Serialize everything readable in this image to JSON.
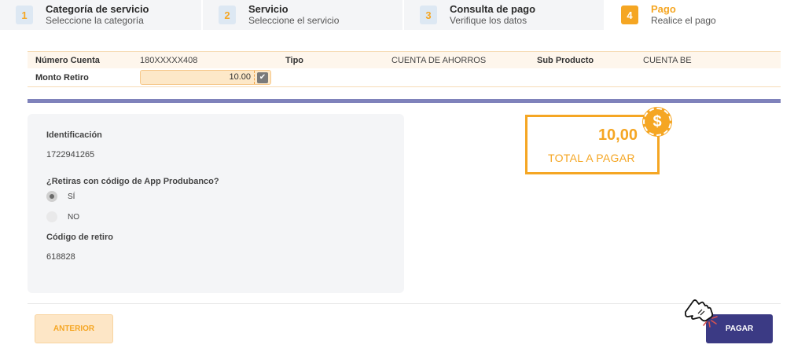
{
  "steps": [
    {
      "num": "1",
      "title": "Categoría de servicio",
      "sub": "Seleccione la categoría"
    },
    {
      "num": "2",
      "title": "Servicio",
      "sub": "Seleccione el servicio"
    },
    {
      "num": "3",
      "title": "Consulta de pago",
      "sub": "Verifique los datos"
    },
    {
      "num": "4",
      "title": "Pago",
      "sub": "Realice el pago"
    }
  ],
  "active_step": 4,
  "account": {
    "numero_label": "Número Cuenta",
    "numero_value": "180XXXXX408",
    "tipo_label": "Tipo",
    "tipo_value": "CUENTA DE AHORROS",
    "subproducto_label": "Sub Producto",
    "subproducto_value": "CUENTA BE",
    "monto_label": "Monto Retiro",
    "monto_value": "10.00"
  },
  "form": {
    "identificacion_label": "Identificación",
    "identificacion_value": "1722941265",
    "pregunta_label": "¿Retiras con código de App Produbanco?",
    "opcion_si": "SÍ",
    "opcion_no": "NO",
    "selected": "SÍ",
    "codigo_label": "Código de retiro",
    "codigo_value": "618828"
  },
  "total": {
    "amount": "10,00",
    "label": "TOTAL A PAGAR",
    "coin_symbol": "$"
  },
  "buttons": {
    "anterior": "ANTERIOR",
    "pagar": "PAGAR"
  },
  "icons": {
    "check": "check-icon",
    "coin": "dollar-coin-icon",
    "cursor": "hand-pointer-icon"
  },
  "colors": {
    "accent": "#f5a623",
    "primary": "#3b3a84",
    "divider": "#7f82bb"
  }
}
